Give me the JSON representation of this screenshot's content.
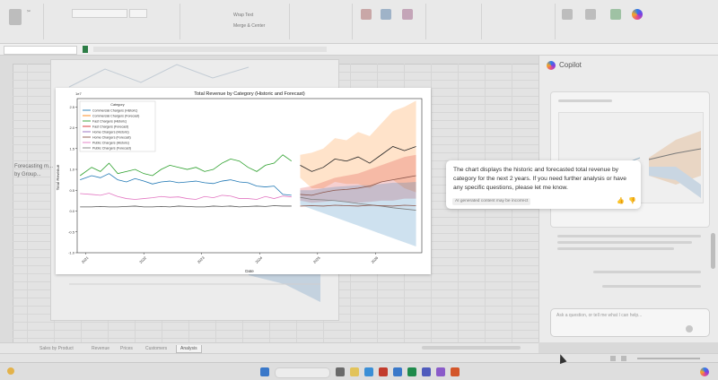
{
  "excel": {
    "sheet_tabs": [
      "Sales by Product",
      "Revenue",
      "Prices",
      "Customers",
      "Analysis"
    ],
    "active_tab_index": 4,
    "side_text": {
      "forecasting": "Forecasting m...",
      "grouped": "by Group..."
    }
  },
  "chart_data": {
    "type": "line",
    "title": "Total Revenue by Category (Historic and Forecast)",
    "xlabel": "Date",
    "ylabel": "Total Revenue",
    "y_scale_note": "1e7",
    "ylim": [
      -1.0,
      2.7
    ],
    "y_ticks": [
      "2.5",
      "2.0",
      "1.5",
      "1.0",
      "0.5",
      "0.0",
      "-0.5",
      "-1.0"
    ],
    "x_ticks": [
      "2021",
      "2022",
      "2023",
      "2024",
      "2025",
      "2026"
    ],
    "legend_title": "Category",
    "legend_position": "top-left",
    "grid": false,
    "series": [
      {
        "name": "Commercial Chargers (Historic)",
        "color": "#1f77b4"
      },
      {
        "name": "Commercial Chargers (Forecast)",
        "color": "#ff7f0e"
      },
      {
        "name": "Fast Chargers (Historic)",
        "color": "#2ca02c"
      },
      {
        "name": "Fast Chargers (Forecast)",
        "color": "#d62728"
      },
      {
        "name": "Home Chargers (Historic)",
        "color": "#9467bd"
      },
      {
        "name": "Home Chargers (Forecast)",
        "color": "#8c564b"
      },
      {
        "name": "Public Chargers (Historic)",
        "color": "#e377c2"
      },
      {
        "name": "Public Chargers (Forecast)",
        "color": "#7f7f7f"
      }
    ],
    "historic_x": [
      2020.9,
      2021.1,
      2021.25,
      2021.4,
      2021.55,
      2021.7,
      2021.85,
      2022.0,
      2022.15,
      2022.3,
      2022.45,
      2022.6,
      2022.75,
      2022.9,
      2023.05,
      2023.2,
      2023.35,
      2023.5,
      2023.65,
      2023.8,
      2023.95,
      2024.1,
      2024.25,
      2024.4,
      2024.55
    ],
    "historic": {
      "commercial": [
        0.75,
        0.85,
        0.8,
        0.9,
        0.75,
        0.7,
        0.78,
        0.72,
        0.65,
        0.7,
        0.72,
        0.68,
        0.7,
        0.72,
        0.68,
        0.66,
        0.72,
        0.75,
        0.7,
        0.68,
        0.6,
        0.58,
        0.6,
        0.4,
        0.38
      ],
      "fast": [
        0.85,
        1.05,
        0.95,
        1.15,
        0.9,
        0.95,
        1.0,
        0.9,
        0.85,
        1.0,
        1.1,
        1.05,
        1.0,
        1.05,
        0.95,
        1.0,
        1.15,
        1.25,
        1.2,
        1.05,
        0.95,
        1.1,
        1.15,
        1.35,
        1.2
      ],
      "home": [
        0.42,
        0.4,
        0.38,
        0.43,
        0.35,
        0.3,
        0.28,
        0.3,
        0.32,
        0.35,
        0.33,
        0.34,
        0.3,
        0.28,
        0.35,
        0.32,
        0.38,
        0.36,
        0.3,
        0.3,
        0.28,
        0.35,
        0.3,
        0.36,
        0.34
      ],
      "public": [
        0.1,
        0.1,
        0.11,
        0.1,
        0.1,
        0.11,
        0.12,
        0.1,
        0.1,
        0.11,
        0.1,
        0.12,
        0.11,
        0.1,
        0.1,
        0.12,
        0.11,
        0.12,
        0.1,
        0.11,
        0.12,
        0.11,
        0.13,
        0.12,
        0.12
      ]
    },
    "forecast_x": [
      2024.7,
      2024.9,
      2025.1,
      2025.3,
      2025.5,
      2025.7,
      2025.9,
      2026.1,
      2026.3,
      2026.5,
      2026.7
    ],
    "forecast": {
      "commercial": [
        0.33,
        0.28,
        0.27,
        0.25,
        0.22,
        0.18,
        0.15,
        0.12,
        0.08,
        0.05,
        0.02
      ],
      "fast": [
        1.1,
        0.95,
        1.05,
        1.25,
        1.2,
        1.3,
        1.15,
        1.35,
        1.55,
        1.45,
        1.55
      ],
      "home": [
        0.4,
        0.38,
        0.45,
        0.5,
        0.52,
        0.55,
        0.6,
        0.7,
        0.75,
        0.8,
        0.85
      ],
      "public": [
        0.12,
        0.13,
        0.12,
        0.14,
        0.13,
        0.12,
        0.14,
        0.13,
        0.12,
        0.14,
        0.13
      ]
    },
    "forecast_bands": {
      "fast": {
        "upper": [
          1.35,
          1.4,
          1.5,
          1.75,
          1.7,
          1.9,
          1.8,
          2.1,
          2.4,
          2.5,
          2.65
        ],
        "lower": [
          0.8,
          0.55,
          0.55,
          0.7,
          0.65,
          0.65,
          0.55,
          0.7,
          0.75,
          0.55,
          0.45
        ]
      },
      "home": {
        "upper": [
          0.55,
          0.6,
          0.7,
          0.8,
          0.85,
          0.9,
          1.0,
          1.1,
          1.2,
          1.3,
          1.35
        ],
        "lower": [
          0.25,
          0.2,
          0.22,
          0.25,
          0.22,
          0.2,
          0.22,
          0.25,
          0.25,
          0.3,
          0.3
        ]
      },
      "commercial": {
        "upper": [
          0.5,
          0.5,
          0.55,
          0.58,
          0.6,
          0.62,
          0.62,
          0.65,
          0.68,
          0.68,
          0.7
        ],
        "lower": [
          0.15,
          0.05,
          -0.05,
          -0.15,
          -0.25,
          -0.35,
          -0.45,
          -0.55,
          -0.65,
          -0.75,
          -0.85
        ]
      }
    }
  },
  "tooltip": {
    "message": "The chart displays the historic and forecasted total revenue by category for the next 2 years. If you need further analysis or have any specific questions, please let me know.",
    "disclaimer": "AI generated content may be incorrect"
  },
  "copilot": {
    "title": "Copilot",
    "input_placeholder": "Ask a question, or tell me what I can help..."
  }
}
